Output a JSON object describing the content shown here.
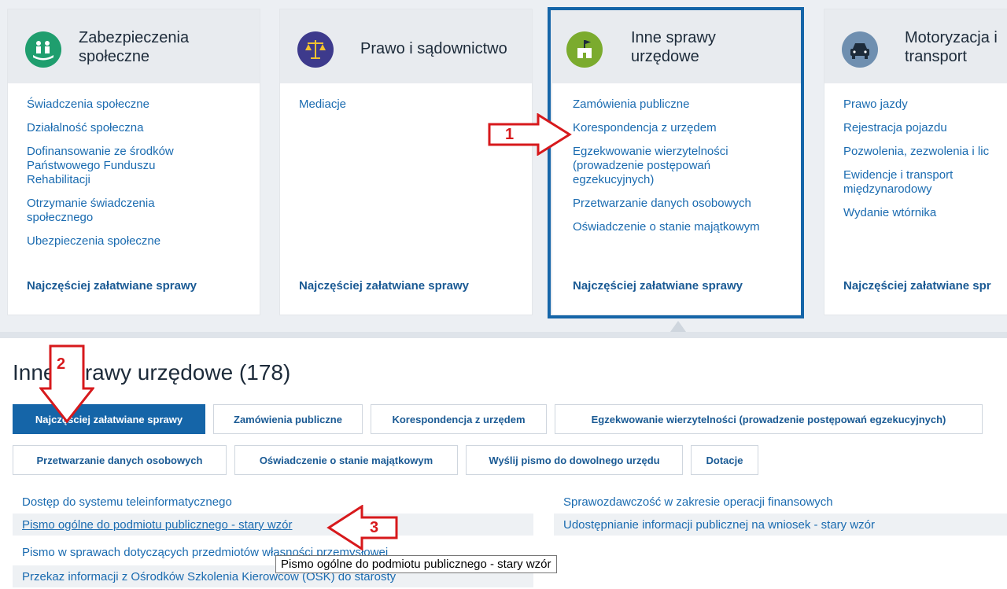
{
  "cards": [
    {
      "title_l1": "Zabezpieczenia",
      "title_l2": "społeczne",
      "links": [
        "Świadczenia społeczne",
        "Działalność społeczna",
        "Dofinansowanie ze środków\nPaństwowego Funduszu\nRehabilitacji",
        "Otrzymanie świadczenia\nspołecznego",
        "Ubezpieczenia społeczne"
      ],
      "footer": "Najczęściej załatwiane sprawy"
    },
    {
      "title_l1": "Prawo i sądownictwo",
      "links": [
        "Mediacje"
      ],
      "footer": "Najczęściej załatwiane sprawy"
    },
    {
      "title_l1": "Inne sprawy",
      "title_l2": "urzędowe",
      "links": [
        "Zamówienia publiczne",
        "Korespondencja z urzędem",
        "Egzekwowanie wierzytelności\n(prowadzenie postępowań\negzekucyjnych)",
        "Przetwarzanie danych osobowych",
        "Oświadczenie o stanie majątkowym"
      ],
      "footer": "Najczęściej załatwiane sprawy"
    },
    {
      "title_l1": "Motoryzacja i",
      "title_l2": "transport",
      "links": [
        "Prawo jazdy",
        "Rejestracja pojazdu",
        "Pozwolenia, zezwolenia i lic",
        "Ewidencje i transport\nmiędzynarodowy",
        "Wydanie wtórnika"
      ],
      "footer": "Najczęściej załatwiane spr"
    }
  ],
  "section": {
    "title": "Inne sprawy urzędowe (178)"
  },
  "chips_row1": [
    "Najczęściej załatwiane sprawy",
    "Zamówienia publiczne",
    "Korespondencja z urzędem",
    "Egzekwowanie wierzytelności (prowadzenie postępowań egzekucyjnych)"
  ],
  "chips_row2": [
    "Przetwarzanie danych osobowych",
    "Oświadczenie o stanie majątkowym",
    "Wyślij pismo do dowolnego urzędu",
    "Dotacje"
  ],
  "left_links": [
    "Dostęp do systemu teleinformatycznego",
    "Pismo ogólne do podmiotu publicznego - stary wzór",
    "Pismo w sprawach dotyczących przedmiotów własności przemysłowej",
    "Przekaz informacji z Ośrodków Szkolenia Kierowców (OSK) do starosty"
  ],
  "right_links": [
    "Sprawozdawczość w zakresie operacji finansowych",
    "Udostępnianie informacji publicznej na wniosek - stary wzór"
  ],
  "tooltip": "Pismo ogólne do podmiotu publicznego - stary wzór",
  "annotations": {
    "a1": "1",
    "a2": "2",
    "a3": "3",
    "color": "#d7191c"
  }
}
